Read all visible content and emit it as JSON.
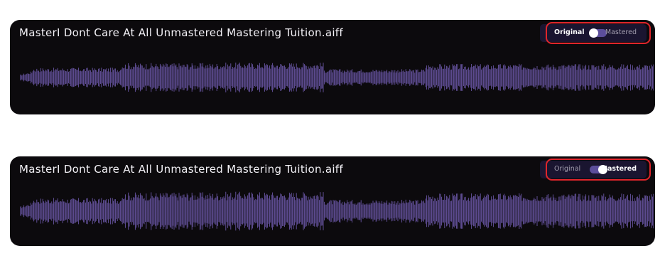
{
  "players": [
    {
      "file_name": "MasterI Dont Care At All Unmastered Mastering Tuition.aiff",
      "toggle": {
        "left_label": "Original",
        "right_label": "Mastered",
        "state": "original"
      },
      "waveform_color": "#6a56a5",
      "highlight_color": "#e0252b"
    },
    {
      "file_name": "MasterI Dont Care At All Unmastered Mastering Tuition.aiff",
      "toggle": {
        "left_label": "Original",
        "right_label": "Mastered",
        "state": "mastered"
      },
      "waveform_color": "#6a56a5",
      "highlight_color": "#e0252b"
    }
  ]
}
